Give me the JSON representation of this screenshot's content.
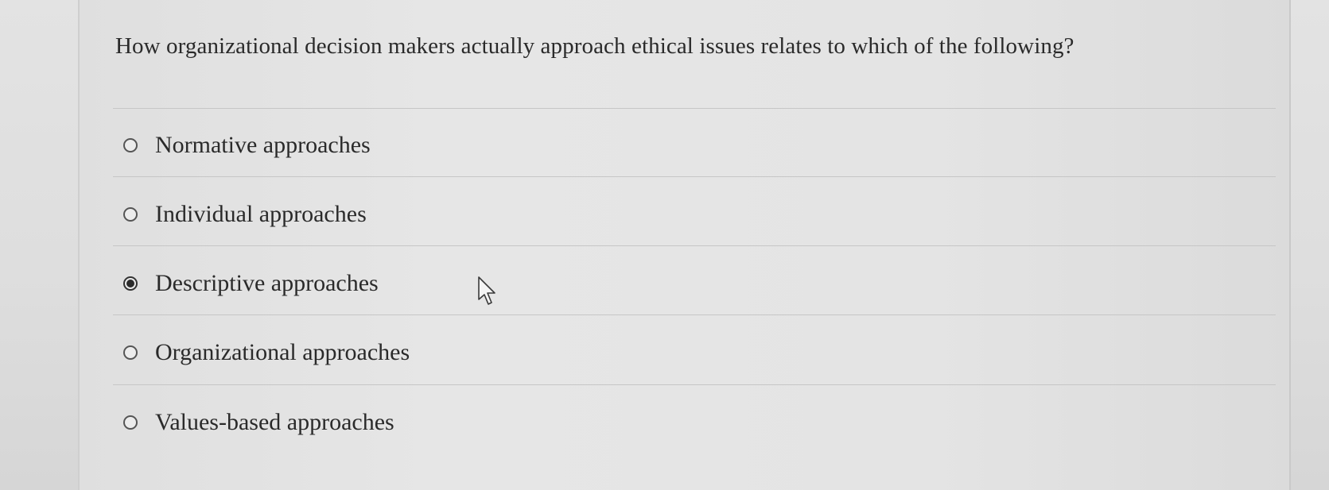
{
  "question": {
    "text": "How organizational decision makers actually approach ethical issues relates to which of the following?"
  },
  "options": [
    {
      "label": "Normative approaches",
      "selected": false
    },
    {
      "label": "Individual approaches",
      "selected": false
    },
    {
      "label": "Descriptive approaches",
      "selected": true
    },
    {
      "label": "Organizational approaches",
      "selected": false
    },
    {
      "label": "Values-based approaches",
      "selected": false
    }
  ],
  "icons": {
    "cursor": "mouse-pointer-icon"
  }
}
